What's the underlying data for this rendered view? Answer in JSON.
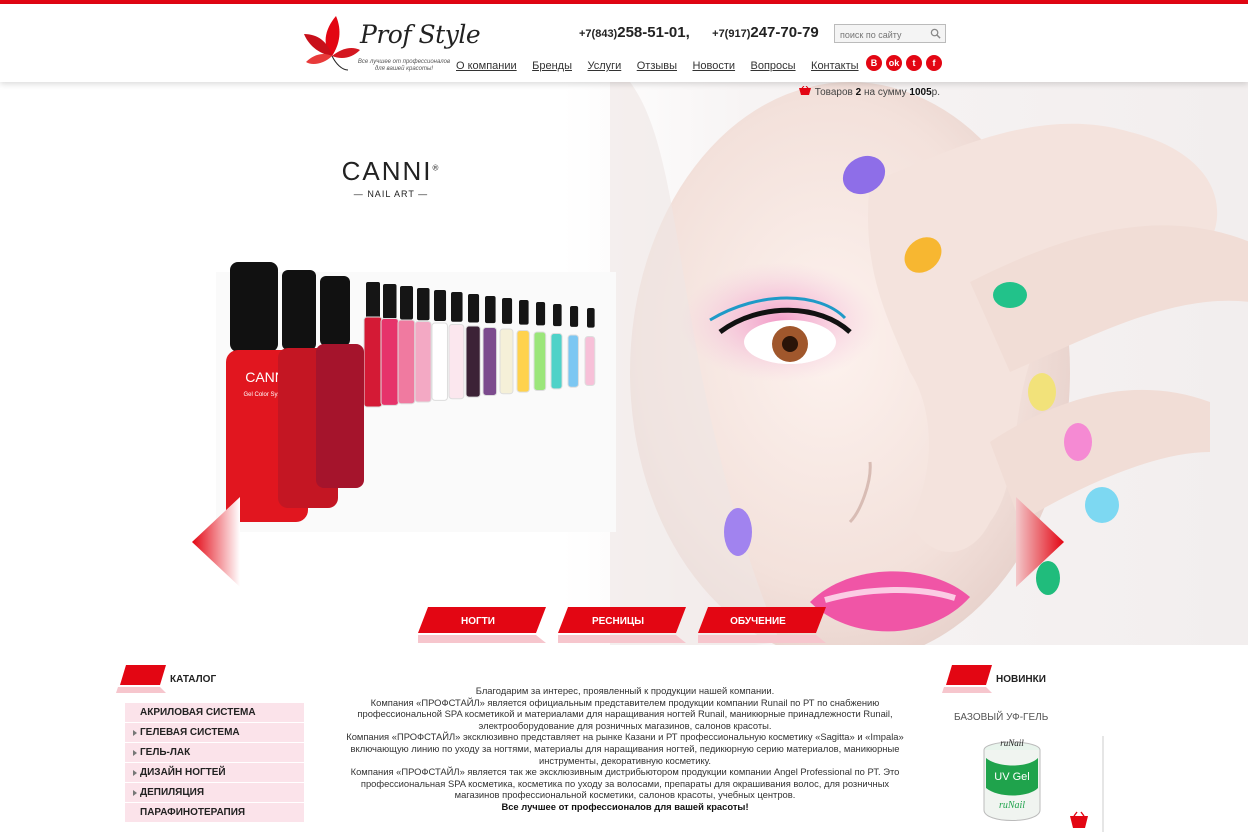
{
  "header": {
    "logo_name": "Prof Style",
    "logo_tagline": "Все лучшее от профессионалов для вашей красоты!",
    "phones": [
      {
        "code": "+7(843)",
        "number": "258-51-01,"
      },
      {
        "code": "+7(917)",
        "number": "247-70-79"
      }
    ],
    "search": {
      "placeholder": "поиск по сайту",
      "icon": "search-icon"
    },
    "nav": [
      "О компании",
      "Бренды",
      "Услуги",
      "Отзывы",
      "Новости",
      "Вопросы",
      "Контакты"
    ],
    "socials": [
      {
        "name": "vk-icon",
        "glyph": "В"
      },
      {
        "name": "odnoklassniki-icon",
        "glyph": "ok"
      },
      {
        "name": "twitter-icon",
        "glyph": "t"
      },
      {
        "name": "facebook-icon",
        "glyph": "f"
      }
    ]
  },
  "cart": {
    "prefix": "Товаров",
    "count": "2",
    "middle": "на сумму",
    "sum": "1005",
    "suffix": "р."
  },
  "hero": {
    "brand": "CANNI",
    "brand_reg": "®",
    "brand_sub": "NAIL ART",
    "bottle_label_brand": "CANNI",
    "bottle_label_text": "Gel Color System",
    "tabs": [
      "НОГТИ",
      "РЕСНИЦЫ",
      "ОБУЧЕНИЕ"
    ],
    "colors": {
      "accent": "#e30613",
      "pink": "#fbe3ea"
    }
  },
  "catalog": {
    "title": "КАТАЛОГ",
    "items": [
      {
        "label": "АКРИЛОВАЯ СИСТЕМА",
        "arrow": false
      },
      {
        "label": "ГЕЛЕВАЯ СИСТЕМА",
        "arrow": true
      },
      {
        "label": "ГЕЛЬ-ЛАК",
        "arrow": true
      },
      {
        "label": "ДИЗАЙН НОГТЕЙ",
        "arrow": true
      },
      {
        "label": "ДЕПИЛЯЦИЯ",
        "arrow": true
      },
      {
        "label": "ПАРАФИНОТЕРАПИЯ",
        "arrow": false
      }
    ]
  },
  "about": {
    "lines": [
      "Благодарим за интерес, проявленный к продукции нашей компании.",
      "Компания «ПРОФСТАЙЛ» является официальным представителем продукции компании Runail по РТ по снабжению профессиональной SPA косметикой и материалами для наращивания ногтей Runail, маникюрные принадлежности Runail, электрооборудование для розничных магазинов, салонов красоты.",
      "Компания «ПРОФСТАЙЛ» эксклюзивно представляет на рынке Казани и РТ профессиональную косметику «Sagitta» и «Impala» включающую линию по уходу за ногтями, материалы для наращивания ногтей, педикюрную серию материалов, маникюрные инструменты, декоративную косметику.",
      "Компания «ПРОФСТАЙЛ» является так же эксклюзивным дистрибьютором продукции компании Angel Professional по РТ. Это профессиональная SPA косметика, косметика по уходу за волосами, препараты для окрашивания волос, для розничных магазинов профессиональной косметики, салонов красоты, учебных центров."
    ],
    "closing": "Все лучшее от профессионалов для вашей красоты!"
  },
  "novelties": {
    "title": "НОВИНКИ",
    "product_title": "БАЗОВЫЙ УФ-ГЕЛЬ",
    "jar_brand": "ruNail",
    "jar_label": "UV Gel"
  }
}
